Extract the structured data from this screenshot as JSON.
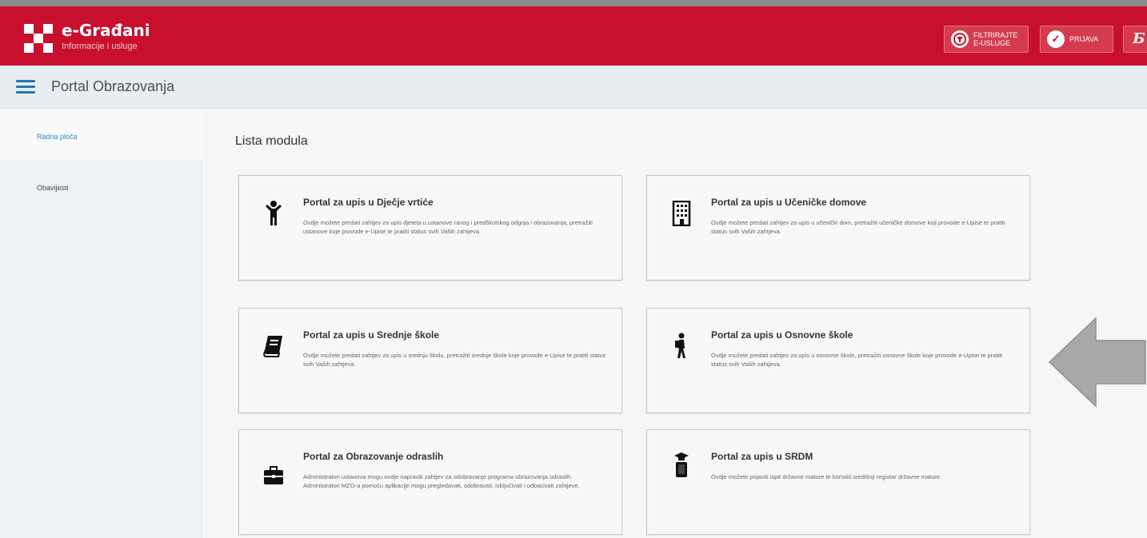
{
  "header": {
    "brand_title": "e-Građani",
    "brand_subtitle": "Informacije i usluge",
    "filter_label_line1": "FILTRIRAJTE",
    "filter_label_line2": "E-USLUGE",
    "filter_icon": "filter-icon",
    "login_label": "PRIJAVA",
    "login_icon": "check-icon",
    "language_label": "Б",
    "brand_color": "#c8102e"
  },
  "subheader": {
    "title": "Portal Obrazovanja",
    "menu_icon": "hamburger-icon"
  },
  "sidebar": {
    "items": [
      {
        "label": "Radna ploča",
        "active": true
      },
      {
        "label": "Obavijesti",
        "active": false
      }
    ]
  },
  "main": {
    "title": "Lista modula",
    "cards": [
      {
        "title": "Portal za upis u Dječje vrtiće",
        "description": "Ovdje možete predati zahtjev za upis djeteta u ustanove ranog i predškolskog odgoja i obrazovanja, pretražiti ustanove koje provode e-Upise te pratiti status svih Vaših zahtjeva.",
        "icon": "child-icon"
      },
      {
        "title": "Portal za upis u Učeničke domove",
        "description": "Ovdje možete predati zahtjev za upis u učenički dom, pretražiti učeničke domove koji provode e-Upise te pratiti status svih Vaših zahtjeva.",
        "icon": "building-icon"
      },
      {
        "title": "Portal za upis u Srednje škole",
        "description": "Ovdje možete predati zahtjev za upis u srednju školu, pretražiti srednje škole koje provode e-Upise te pratiti status svih Vaših zahtjeva.",
        "icon": "book-icon"
      },
      {
        "title": "Portal za upis u Osnovne škole",
        "description": "Ovdje možete predati zahtjev za upis u osnovne škole, pretražiti osnovne škole koje provode e-Upise te pratiti status svih Vaših zahtjeva.",
        "icon": "pupil-icon"
      },
      {
        "title": "Portal za Obrazovanje odraslih",
        "description": "Administratori ustanova mogu ovdje napraviti zahtjev za odobravanje programa obrazovanja odraslih. Administratori MZO-a pomoću aplikacije mogu pregledavati, odobravati, isključivati i odbacivati zahtjeve.",
        "icon": "briefcase-icon"
      },
      {
        "title": "Portal za upis u SRDM",
        "description": "Ovdje možete prijaviti ispit državne mature te koristiti središnji registar državne mature.",
        "icon": "graduate-icon"
      }
    ]
  },
  "annotation": {
    "arrow_icon": "left-arrow-icon",
    "arrow_color": "#a8a8a8"
  }
}
